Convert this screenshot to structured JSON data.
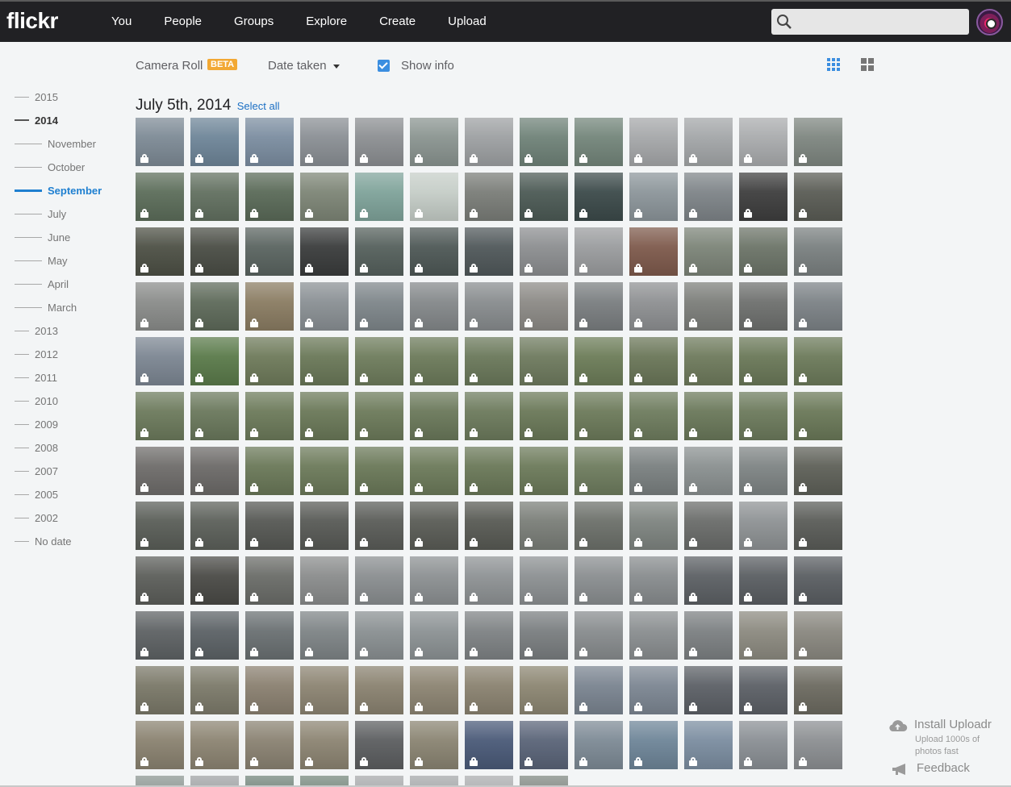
{
  "brand": {
    "logo": "flickr"
  },
  "nav": {
    "links": [
      "You",
      "People",
      "Groups",
      "Explore",
      "Create",
      "Upload"
    ],
    "search_placeholder": ""
  },
  "toolbar": {
    "camera_roll": "Camera Roll",
    "beta_badge": "BETA",
    "sort_label": "Date taken",
    "show_info_label": "Show info",
    "show_info_checked": true
  },
  "timeline": [
    {
      "label": "2015",
      "level": "year"
    },
    {
      "label": "2014",
      "level": "year",
      "state": "current"
    },
    {
      "label": "November",
      "level": "month"
    },
    {
      "label": "October",
      "level": "month"
    },
    {
      "label": "September",
      "level": "month",
      "state": "active"
    },
    {
      "label": "July",
      "level": "month"
    },
    {
      "label": "June",
      "level": "month"
    },
    {
      "label": "May",
      "level": "month"
    },
    {
      "label": "April",
      "level": "month"
    },
    {
      "label": "March",
      "level": "month"
    },
    {
      "label": "2013",
      "level": "year"
    },
    {
      "label": "2012",
      "level": "year"
    },
    {
      "label": "2011",
      "level": "year"
    },
    {
      "label": "2010",
      "level": "year"
    },
    {
      "label": "2009",
      "level": "year"
    },
    {
      "label": "2008",
      "level": "year"
    },
    {
      "label": "2007",
      "level": "year"
    },
    {
      "label": "2005",
      "level": "year"
    },
    {
      "label": "2002",
      "level": "year"
    },
    {
      "label": "No date",
      "level": "year"
    }
  ],
  "section": {
    "date_title": "July 5th, 2014",
    "select_all": "Select all",
    "photo_count": 164,
    "private_icon": "lock-icon",
    "tones": [
      "#7d8a95",
      "#6e8598",
      "#7b8da0",
      "#8a8f94",
      "#8c8f92",
      "#8a9490",
      "#9da0a2",
      "#6f8278",
      "#73857a",
      "#a5a7a9",
      "#a3a6a8",
      "#a9abad",
      "#7e8680",
      "#5c6d5a",
      "#627060",
      "#5a6a58",
      "#7d8576",
      "#7fa39a",
      "#c5cdc7",
      "#7a7d78",
      "#4c5a55",
      "#3c4a4a",
      "#8c959a",
      "#7e8488",
      "#3e3e3e",
      "#5a5c55",
      "#4d5045",
      "#4a4d45",
      "#5a6460",
      "#3a3c3c",
      "#55605c",
      "#4e5856",
      "#50585a",
      "#8c8e90",
      "#9a9c9e",
      "#7e5a4c",
      "#7c8478",
      "#6c7468",
      "#7a8080",
      "#8a8c8a",
      "#5e6a5a",
      "#8a7c62",
      "#8a9094",
      "#7e868a",
      "#84888a",
      "#888c8e",
      "#8c8a86",
      "#7a7e80",
      "#8e9092",
      "#7c7e7a",
      "#6e706e",
      "#7c8286",
      "#7c8692",
      "#5a7a4a",
      "#6e7a5a",
      "#6a7858",
      "#6e7c5c",
      "#6c7a5a",
      "#6a785a",
      "#6e7a5e",
      "#6c7c58",
      "#6a7658",
      "#6e7a5c",
      "#6a7858",
      "#6c7a5a",
      "#6c7a5c",
      "#6a785c",
      "#6c7a5a",
      "#6a7858",
      "#6c7a5a",
      "#6a785a",
      "#6c7a5c",
      "#6a7858",
      "#6c7a5a",
      "#6e7c5e",
      "#6a785a",
      "#6c7a5c",
      "#6a7858",
      "#6e6c6a",
      "#6c6a68",
      "#6a7858",
      "#6c7a5a",
      "#6a7858",
      "#6c7a5a",
      "#6a7858",
      "#6c7a5a",
      "#6e7c5e",
      "#7a8080",
      "#8a9090",
      "#7e8484",
      "#5e6058",
      "#5a5e58",
      "#5c605a",
      "#565854",
      "#585a56",
      "#5a5c58",
      "#5a5c56",
      "#585a54",
      "#7a7e78",
      "#6c706a",
      "#7e8480",
      "#6a6c6a",
      "#8e9294",
      "#5a5c58",
      "#5c5e5a",
      "#4a4a46",
      "#6a6c68",
      "#8a8c8c",
      "#8a8e90",
      "#8c9092",
      "#8e9294",
      "#8c9092",
      "#8a8e90",
      "#888c8e",
      "#5c6064",
      "#5a5e62",
      "#5a5e62",
      "#5e6264",
      "#5c6266",
      "#6a7072",
      "#7e8486",
      "#8a9092",
      "#8c9294",
      "#7e8284",
      "#7a7e80",
      "#888c8e",
      "#8a8e90",
      "#7c8082",
      "#8c8a80",
      "#8a8880",
      "#7a7868",
      "#7c7a6a",
      "#8a8070",
      "#8c8472",
      "#8a8270",
      "#8c8472",
      "#8a8270",
      "#8c8672",
      "#7a8490",
      "#7c8692",
      "#5c6066",
      "#5c6066",
      "#6c6a60",
      "#8a8270",
      "#8c8472",
      "#8a8272",
      "#8c8472",
      "#5c5e60",
      "#8a8472",
      "#4a5a78",
      "#5a6478"
    ]
  }
}
